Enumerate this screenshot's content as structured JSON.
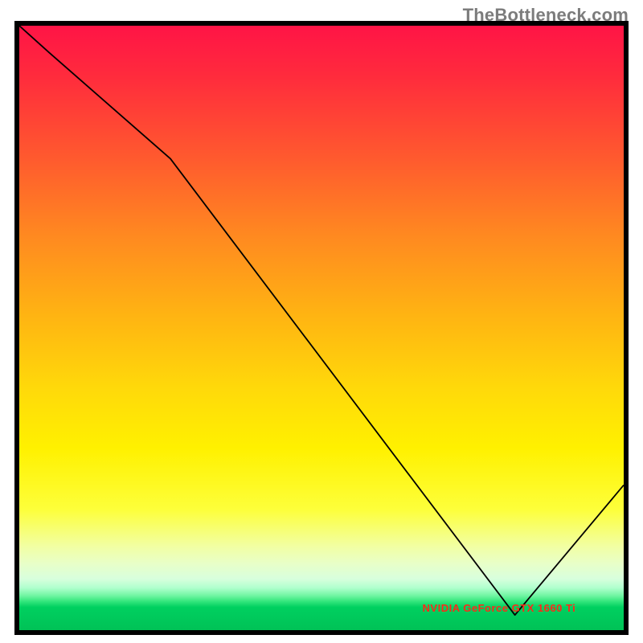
{
  "attribution": "TheBottleneck.com",
  "floor_label": "NVIDIA GeForce GTX 1660 Ti",
  "chart_data": {
    "type": "line",
    "title": "",
    "xlabel": "",
    "ylabel": "",
    "x": [
      0.0,
      0.05,
      0.25,
      0.82,
      1.0
    ],
    "values": [
      1.0,
      0.955,
      0.78,
      0.025,
      0.24
    ],
    "xlim": [
      0,
      1
    ],
    "ylim": [
      0,
      1
    ],
    "annotations": [
      {
        "text_key": "floor_label",
        "x": 0.78,
        "y": 0.025
      }
    ],
    "gradient_scale": "bottleneck_heat"
  }
}
